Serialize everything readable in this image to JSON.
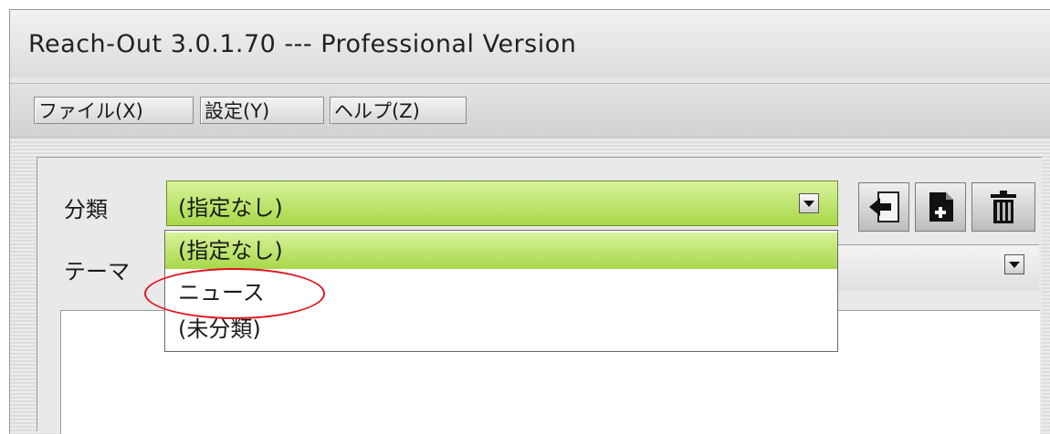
{
  "window": {
    "title": "Reach-Out 3.0.1.70 --- Professional Version"
  },
  "menu": {
    "file": "ファイル(X)",
    "settings": "設定(Y)",
    "help": "ヘルプ(Z)"
  },
  "form": {
    "category_label": "分類",
    "theme_label": "テーマ",
    "category_value": "(指定なし)"
  },
  "category_options": [
    "(指定なし)",
    "ニュース",
    "(未分類)"
  ],
  "highlight": {
    "color": "#e0141e",
    "target": "ニュース"
  },
  "colors": {
    "selection": "#b8e060",
    "window_bg": "#e6e6e6"
  },
  "icons": {
    "import": "import-icon",
    "new": "new-document-icon",
    "delete": "trash-icon"
  }
}
